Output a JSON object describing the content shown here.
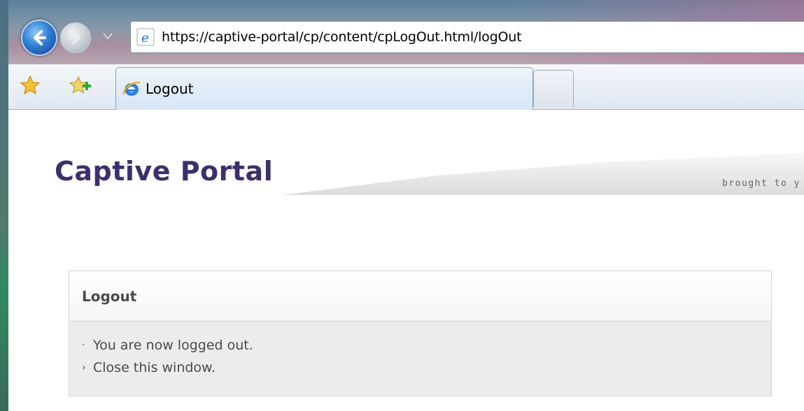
{
  "browser": {
    "url": "https://captive-portal/cp/content/cpLogOut.html/logOut",
    "tabs": [
      {
        "label": "Logout"
      }
    ]
  },
  "page": {
    "brand": "Captive Portal",
    "tagline": "brought to y",
    "panel": {
      "title": "Logout",
      "message": "You are now logged out.",
      "link": "Close this window."
    }
  }
}
